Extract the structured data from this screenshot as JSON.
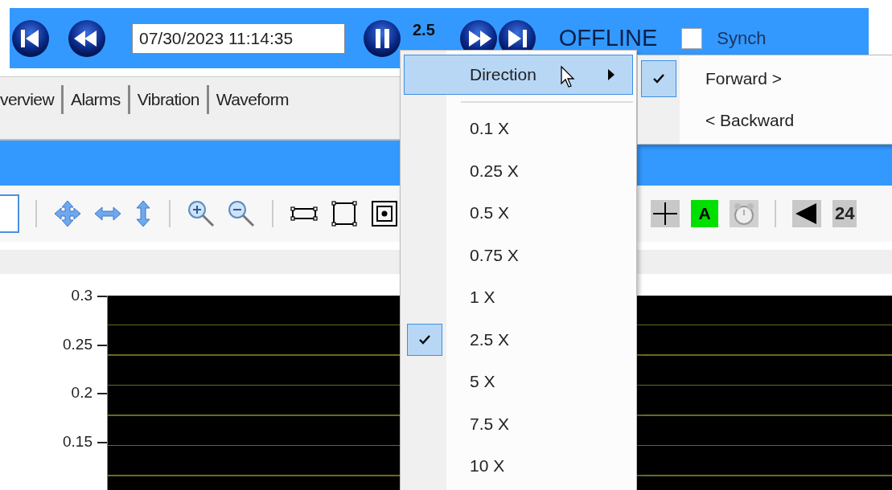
{
  "transport": {
    "date_time": "07/30/2023 11:14:35",
    "speed": "2.5",
    "status": "OFFLINE",
    "synch": {
      "label": "Synch",
      "checked": false
    }
  },
  "tabs": [
    {
      "label": "verview"
    },
    {
      "label": "Alarms"
    },
    {
      "label": "Vibration"
    },
    {
      "label": "Waveform"
    }
  ],
  "toolbar": {
    "auto_label": "A",
    "page": "24"
  },
  "chart": {
    "yticks": [
      "0.3",
      "0.25",
      "0.2",
      "0.15"
    ]
  },
  "context_menu": {
    "items": [
      {
        "kind": "submenu",
        "label": "Direction",
        "highlighted": true
      },
      {
        "kind": "separator"
      },
      {
        "kind": "option",
        "label": "0.1 X",
        "checked": false
      },
      {
        "kind": "option",
        "label": "0.25 X",
        "checked": false
      },
      {
        "kind": "option",
        "label": "0.5 X",
        "checked": false
      },
      {
        "kind": "option",
        "label": "0.75 X",
        "checked": false
      },
      {
        "kind": "option",
        "label": "1 X",
        "checked": false
      },
      {
        "kind": "option",
        "label": "2.5 X",
        "checked": true
      },
      {
        "kind": "option",
        "label": "5 X",
        "checked": false
      },
      {
        "kind": "option",
        "label": "7.5 X",
        "checked": false
      },
      {
        "kind": "option",
        "label": "10 X",
        "checked": false
      }
    ]
  },
  "submenu": {
    "items": [
      {
        "label": "Forward >",
        "checked": true
      },
      {
        "label": "< Backward",
        "checked": false
      }
    ]
  }
}
